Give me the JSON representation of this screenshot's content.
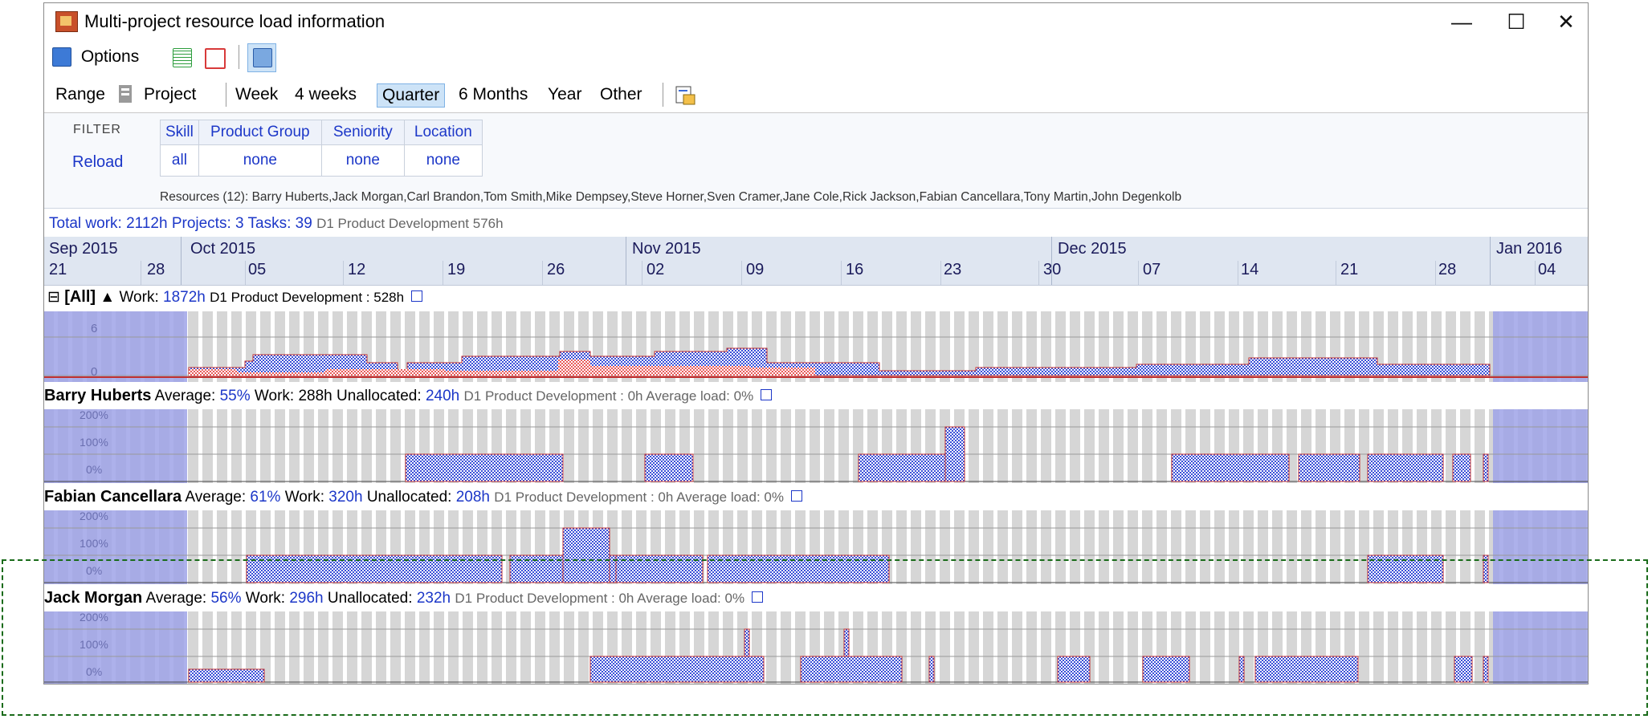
{
  "window": {
    "title": "Multi-project resource load information",
    "controls": {
      "minimize": "—",
      "maximize": "☐",
      "close": "✕"
    }
  },
  "toolbar": {
    "options_label": "Options",
    "range_label": "Range",
    "project_label": "Project",
    "ranges": [
      "Week",
      "4 weeks",
      "Quarter",
      "6 Months",
      "Year",
      "Other"
    ],
    "selected_range": "Quarter"
  },
  "filter": {
    "label": "FILTER",
    "reload": "Reload",
    "columns": [
      "Skill",
      "Product Group",
      "Seniority",
      "Location"
    ],
    "values": [
      "all",
      "none",
      "none",
      "none"
    ],
    "resources_text": "Resources (12):  Barry Huberts,Jack Morgan,Carl Brandon,Tom Smith,Mike Dempsey,Steve Horner,Sven Cramer,Jane Cole,Rick Jackson,Fabian Cancellara,Tony Martin,John Degenkolb"
  },
  "summary": {
    "total_label": "Total work:",
    "total": "2112h",
    "projects_label": "Projects:",
    "projects": "3",
    "tasks_label": "Tasks:",
    "tasks": "39",
    "project_note": "D1 Product Development 576h"
  },
  "timeline": {
    "months": [
      "Sep 2015",
      "Oct 2015",
      "Nov 2015",
      "Dec 2015",
      "Jan 2016"
    ],
    "days": [
      "21",
      "28",
      "05",
      "12",
      "19",
      "26",
      "02",
      "09",
      "16",
      "23",
      "30",
      "07",
      "14",
      "21",
      "28",
      "04"
    ]
  },
  "groups": [
    {
      "toggle": "⊟",
      "name": "[All]",
      "sort": "▲",
      "work_label": "Work:",
      "work": "1872h",
      "project_note": "D1 Product Development : 528h",
      "axis": [
        "6",
        "0"
      ]
    }
  ],
  "resources": [
    {
      "name": "Barry Huberts",
      "avg_label": "Average:",
      "average": "55%",
      "work_label": "Work:",
      "work": "288h",
      "unalloc_label": "Unallocated:",
      "unallocated": "240h",
      "project_note": "D1 Product Development : 0h Average load: 0%",
      "axis": [
        "200%",
        "100%",
        "0%"
      ]
    },
    {
      "name": "Fabian Cancellara",
      "avg_label": "Average:",
      "average": "61%",
      "work_label": "Work:",
      "work": "320h",
      "unalloc_label": "Unallocated:",
      "unallocated": "208h",
      "project_note": "D1 Product Development : 0h Average load: 0%",
      "axis": [
        "200%",
        "100%",
        "0%"
      ]
    },
    {
      "name": "Jack Morgan",
      "avg_label": "Average:",
      "average": "56%",
      "work_label": "Work:",
      "work": "296h",
      "unalloc_label": "Unallocated:",
      "unallocated": "232h",
      "project_note": "D1 Product Development : 0h Average load: 0%",
      "axis": [
        "200%",
        "100%",
        "0%"
      ]
    }
  ],
  "colors": {
    "load_blue": "#3a4fd8",
    "project_red": "#e85a5a",
    "weekend_gray": "#d6d6d6",
    "outside_range": "#9fa3e8",
    "overlay_green": "#1a6b1a"
  }
}
